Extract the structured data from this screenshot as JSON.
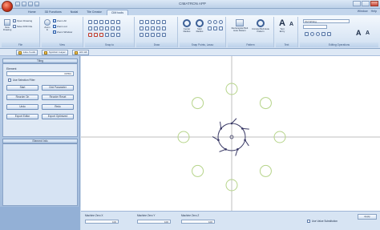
{
  "window": {
    "title": "CIMATRON APP"
  },
  "tabs": [
    "Home",
    "3D Functions",
    "Nodal",
    "Tile Creator",
    "CIM tools"
  ],
  "active_tab": "CIM tools",
  "help": {
    "label": "Window",
    "help_label": "Help"
  },
  "ribbon_groups": [
    {
      "label": "File"
    },
    {
      "label": "View"
    },
    {
      "label": "Snap to"
    },
    {
      "label": "Draw"
    },
    {
      "label": "Snap Points, Lasso"
    },
    {
      "label": "Shape Set / Rotation"
    },
    {
      "label": "Pattern"
    },
    {
      "label": "Text"
    },
    {
      "label": "Editing Operations"
    }
  ],
  "file_group": {
    "new_label": "New Drawing",
    "recent_label": "Open Drawing",
    "save_label": "Save DXF File"
  },
  "view_group": {
    "zoom_all": "Zoom All",
    "zoom_out": "Zoom out",
    "zoom_window": "Zoom Window",
    "pan_label": "Zoom In"
  },
  "shape_group": {
    "circle_label": "Center Radius",
    "poly_label": "Start Radius"
  },
  "pattern_group": {
    "rect_label": "Rectangular Bolt Hole Pattern",
    "circle_label": "Circular Bolt Hole Pattern"
  },
  "text_group": {
    "label": "Text Entry"
  },
  "editing": {
    "font_value": "Old Writing"
  },
  "subbar": {
    "btn1": "Line / Lock",
    "btn2": "Symbol / Layer",
    "btn3": "All / All"
  },
  "left_panel": {
    "title": "Tiling",
    "element_label": "Element",
    "element_value": "0/PM1",
    "checkbox_label": "Use Selection Filter",
    "buttons": [
      "Start",
      "Grid Parameter",
      "Reorder On",
      "Reorder Reset",
      "Undo",
      "Redo",
      "Export Editor",
      "Export Optimized"
    ],
    "section2_title": "Element Info"
  },
  "status": {
    "x_label": "Machine Zero X",
    "y_label": "Machine Zero Y",
    "z_label": "Machine Zero Z",
    "x_value": "100",
    "y_value": "100",
    "z_value": "100",
    "checkbox_label": "Use Value Substitution",
    "apply_label": "Apply"
  },
  "colors": {
    "ring": "#b6d48a",
    "crosshair": "#bfbfbf",
    "part": "#3a3a66"
  },
  "canvas": {
    "holes": 8,
    "part_arms": 7
  }
}
